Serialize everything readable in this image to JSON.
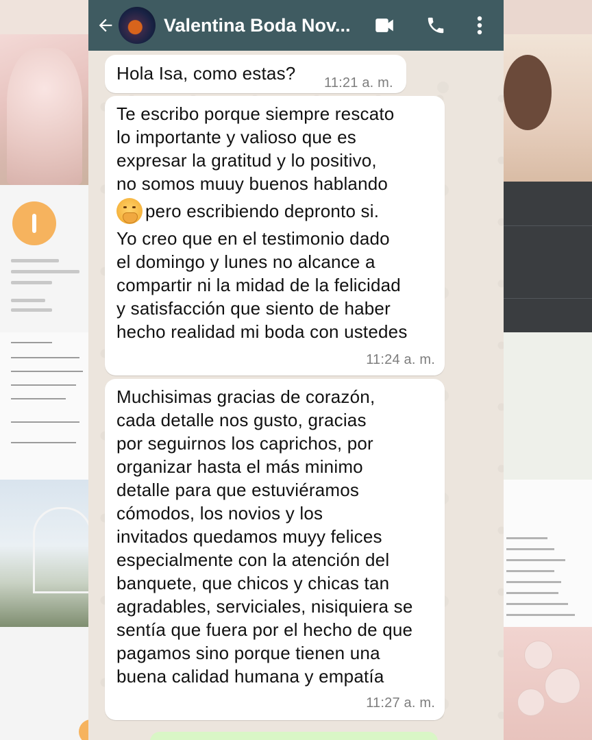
{
  "header": {
    "contact_name": "Valentina Boda Nov...",
    "icons": [
      "back-arrow-icon",
      "contact-avatar",
      "video-call-icon",
      "phone-call-icon",
      "more-vert-icon"
    ]
  },
  "messages": [
    {
      "lines": [
        "Hola Isa, como estas?"
      ],
      "time": "11:21 a. m."
    },
    {
      "lines": [
        "Te escribo porque siempre rescato",
        "lo importante y valioso que es",
        "expresar la gratitud y lo positivo,",
        "no somos muuy buenos hablando",
        "pero escribiendo depronto si.",
        "Yo creo que en el testimonio dado",
        "el domingo y lunes no alcance a",
        "compartir ni la midad de la felicidad",
        "y satisfacción que siento de haber",
        "hecho realidad mi boda con ustedes"
      ],
      "time": "11:24 a. m."
    },
    {
      "lines": [
        "Muchisimas gracias de corazón,",
        "cada detalle nos gusto, gracias",
        "por seguirnos los caprichos, por",
        "organizar hasta el más minimo",
        "detalle para que estuviéramos",
        "cómodos, los novios y los",
        "invitados quedamos muyy felices",
        "especialmente con la atención del",
        "banquete, que chicos y chicas tan",
        "agradables, serviciales, nisiquiera se",
        "sentía que fuera por el hecho de que",
        "pagamos sino porque tienen una",
        "buena calidad humana y empatía"
      ],
      "time": "11:27 a. m."
    }
  ],
  "colors": {
    "header_bg": "#3f5b61",
    "chat_bg": "#ece5dd",
    "bubble_bg": "#ffffff",
    "time_color": "#7d7d7d"
  }
}
